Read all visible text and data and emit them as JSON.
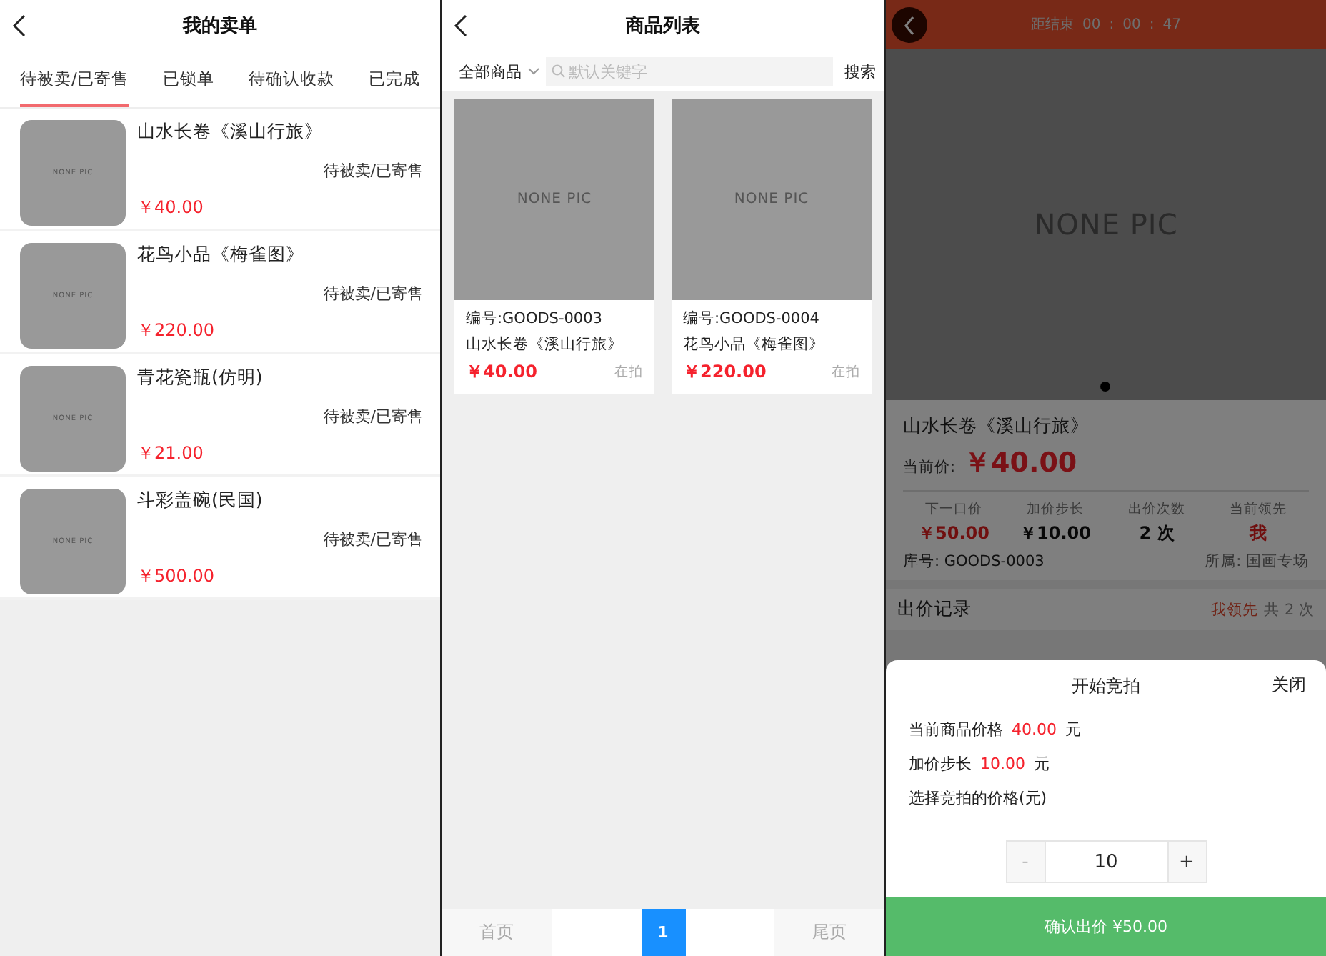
{
  "orders_screen": {
    "title": "我的卖单",
    "tabs": [
      {
        "label": "待被卖/已寄售",
        "selected": true
      },
      {
        "label": "已锁单",
        "selected": false
      },
      {
        "label": "待确认收款",
        "selected": false
      },
      {
        "label": "已完成",
        "selected": false
      }
    ],
    "orders": [
      {
        "image_text": "NONE PIC",
        "name": "山水长卷《溪山行旅》",
        "status": "待被卖/已寄售",
        "price": "￥40.00"
      },
      {
        "image_text": "NONE PIC",
        "name": "花鸟小品《梅雀图》",
        "status": "待被卖/已寄售",
        "price": "￥220.00"
      },
      {
        "image_text": "NONE PIC",
        "name": "青花瓷瓶(仿明)",
        "status": "待被卖/已寄售",
        "price": "￥21.00"
      },
      {
        "image_text": "NONE PIC",
        "name": "斗彩盖碗(民国)",
        "status": "待被卖/已寄售",
        "price": "￥500.00"
      }
    ]
  },
  "goods_screen": {
    "title": "商品列表",
    "category": "全部商品",
    "search": {
      "placeholder": "默认关键字"
    },
    "search_button": "搜索",
    "goods": [
      {
        "image_text": "NONE PIC",
        "code": "编号:GOODS-0003",
        "name": "山水长卷《溪山行旅》",
        "price": "￥40.00",
        "status": "在拍"
      },
      {
        "image_text": "NONE PIC",
        "code": "编号:GOODS-0004",
        "name": "花鸟小品《梅雀图》",
        "price": "￥220.00",
        "status": "在拍"
      }
    ],
    "pagination": {
      "first": "首页",
      "pages": [
        {
          "label": "1",
          "selected": true
        }
      ],
      "last": "尾页"
    }
  },
  "auction_screen": {
    "countdown_label": "距结束",
    "countdown": [
      "00",
      "00",
      "47"
    ],
    "countdown_separator": ":",
    "image_text": "NONE PIC",
    "title": "山水长卷《溪山行旅》",
    "current_price_label": "当前价:",
    "current_price": "￥40.00",
    "stats": [
      {
        "label": "下一口价",
        "value": "￥50.00",
        "highlight": true
      },
      {
        "label": "加价步长",
        "value": "￥10.00",
        "highlight": false
      },
      {
        "label": "出价次数",
        "value": "2 次",
        "highlight": false
      },
      {
        "label": "当前领先",
        "value": "我",
        "highlight": true
      }
    ],
    "stock_no": "库号: GOODS-0003",
    "belongs": "所属: 国画专场",
    "bid_records_title": "出价记录",
    "leader": "我领先",
    "bid_total": "共 2 次",
    "bid_sheet": {
      "title": "开始竞拍",
      "close": "关闭",
      "lines": [
        {
          "label": "当前商品价格",
          "value": "40.00",
          "unit": "元"
        },
        {
          "label": "加价步长",
          "value": "10.00",
          "unit": "元"
        }
      ],
      "choose_label": "选择竞拍的价格(元)",
      "minus": "-",
      "quantity": "10",
      "plus": "+",
      "confirm": "确认出价 ¥50.00"
    }
  }
}
